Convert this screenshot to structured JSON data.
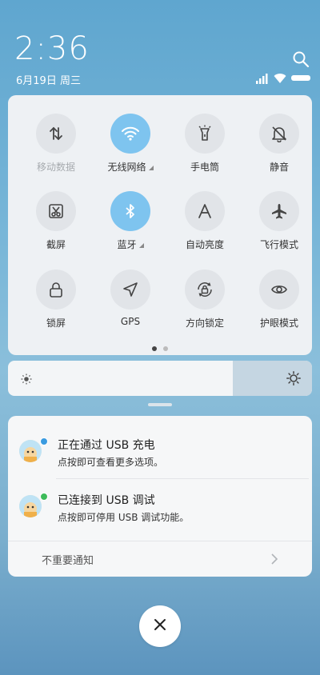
{
  "status": {
    "time": "2:36",
    "date": "6月19日 周三"
  },
  "quick_settings": {
    "tiles": [
      {
        "label": "移动数据",
        "icon": "mobile-data-icon",
        "active": false,
        "dim": true
      },
      {
        "label": "无线网络",
        "icon": "wifi-icon",
        "active": true,
        "dim": false,
        "has_more": true
      },
      {
        "label": "手电筒",
        "icon": "flashlight-icon",
        "active": false,
        "dim": false
      },
      {
        "label": "静音",
        "icon": "mute-bell-icon",
        "active": false,
        "dim": false
      },
      {
        "label": "截屏",
        "icon": "screenshot-icon",
        "active": false,
        "dim": false
      },
      {
        "label": "蓝牙",
        "icon": "bluetooth-icon",
        "active": true,
        "dim": false,
        "has_more": true
      },
      {
        "label": "自动亮度",
        "icon": "auto-brightness-icon",
        "active": false,
        "dim": false
      },
      {
        "label": "飞行模式",
        "icon": "airplane-icon",
        "active": false,
        "dim": false
      },
      {
        "label": "锁屏",
        "icon": "lock-icon",
        "active": false,
        "dim": false
      },
      {
        "label": "GPS",
        "icon": "gps-icon",
        "active": false,
        "dim": false
      },
      {
        "label": "方向锁定",
        "icon": "rotation-lock-icon",
        "active": false,
        "dim": false
      },
      {
        "label": "护眼模式",
        "icon": "eye-icon",
        "active": false,
        "dim": false
      }
    ],
    "page_count": 2,
    "current_page": 1
  },
  "brightness": {
    "level": 0.74
  },
  "notifications": [
    {
      "title": "正在通过 USB 充电",
      "body": "点按即可查看更多选项。",
      "badge_color": "#3a9be0"
    },
    {
      "title": "已连接到 USB 调试",
      "body": "点按即可停用 USB 调试功能。",
      "badge_color": "#3dbb5a"
    }
  ],
  "unimportant_label": "不重要通知",
  "colors": {
    "accent": "#7ec4ef",
    "tile_inactive": "#e1e4e8",
    "dot_active": "#444444",
    "dot_inactive": "#bbbbbb"
  }
}
